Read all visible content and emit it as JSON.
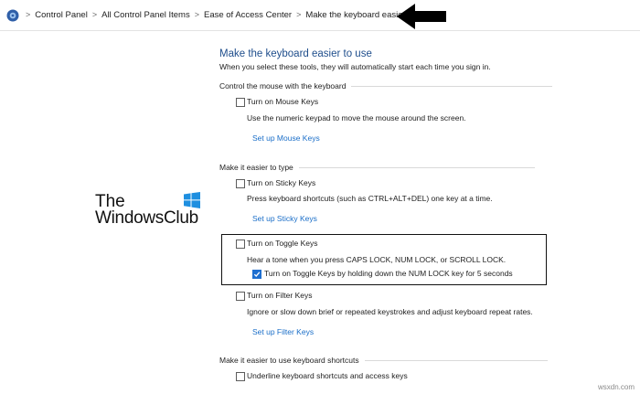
{
  "breadcrumb": {
    "items": [
      "Control Panel",
      "All Control Panel Items",
      "Ease of Access Center",
      "Make the keyboard easier to use"
    ],
    "separator": ">"
  },
  "page": {
    "title": "Make the keyboard easier to use",
    "subtitle": "When you select these tools, they will automatically start each time you sign in."
  },
  "sections": {
    "mouse": {
      "heading": "Control the mouse with the keyboard",
      "option_label": "Turn on Mouse Keys",
      "option_checked": false,
      "description": "Use the numeric keypad to move the mouse around the screen.",
      "link": "Set up Mouse Keys"
    },
    "typing": {
      "heading": "Make it easier to type",
      "sticky_label": "Turn on Sticky Keys",
      "sticky_checked": false,
      "sticky_description": "Press keyboard shortcuts (such as CTRL+ALT+DEL) one key at a time.",
      "sticky_link": "Set up Sticky Keys",
      "toggle_label": "Turn on Toggle Keys",
      "toggle_checked": false,
      "toggle_description": "Hear a tone when you press CAPS LOCK, NUM LOCK, or SCROLL LOCK.",
      "toggle_hold_label": "Turn on Toggle Keys by holding down the NUM LOCK key for 5 seconds",
      "toggle_hold_checked": true,
      "filter_label": "Turn on Filter Keys",
      "filter_checked": false,
      "filter_description": "Ignore or slow down brief or repeated keystrokes and adjust keyboard repeat rates.",
      "filter_link": "Set up Filter Keys"
    },
    "shortcuts": {
      "heading": "Make it easier to use keyboard shortcuts",
      "underline_label": "Underline keyboard shortcuts and access keys",
      "underline_checked": false
    }
  },
  "watermark": {
    "line1": "The",
    "line2": "WindowsClub",
    "footer": "wsxdn.com"
  },
  "colors": {
    "title": "#1f4e8c",
    "link": "#1a6ec8",
    "checkbox_checked": "#1e6fd0",
    "windows_logo": "#1e8fe0"
  }
}
